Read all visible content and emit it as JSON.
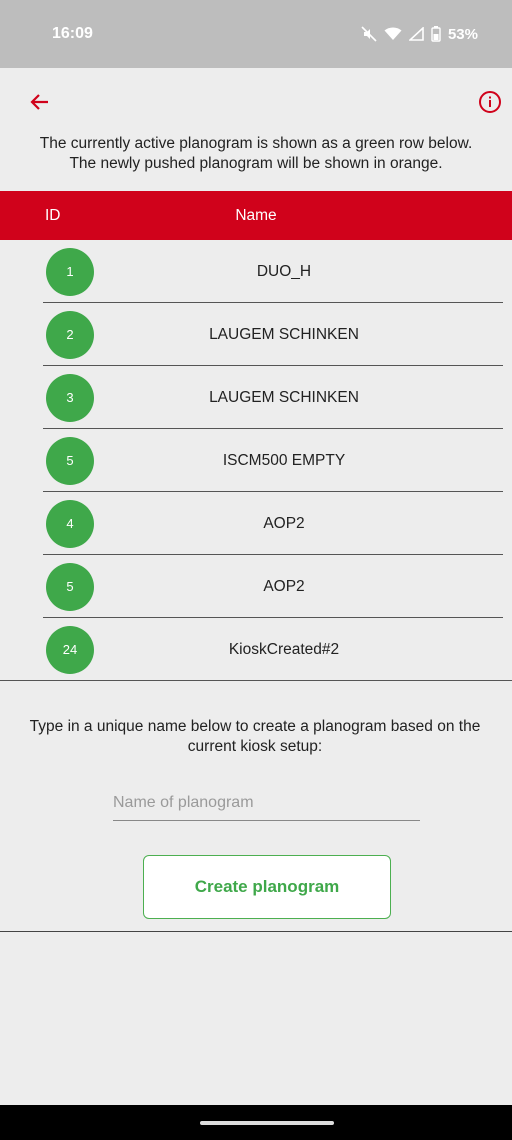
{
  "status_bar": {
    "time": "16:09",
    "battery": "53%",
    "icons": [
      "mute-icon",
      "wifi-icon",
      "signal-icon",
      "battery-icon"
    ]
  },
  "toolbar": {
    "back_icon": "arrow-left-icon",
    "info_icon": "info-circle-icon",
    "accent_color": "#d0021b"
  },
  "intro_text": {
    "line1": "The currently active planogram is shown as a green row below.",
    "line2": "The newly pushed planogram will be shown in orange."
  },
  "table": {
    "header_id": "ID",
    "header_name": "Name",
    "header_color": "#d0021b",
    "badge_color": "#3fa84a",
    "rows": [
      {
        "id": "1",
        "name": "DUO_H"
      },
      {
        "id": "2",
        "name": "LAUGEM SCHINKEN"
      },
      {
        "id": "3",
        "name": "LAUGEM SCHINKEN"
      },
      {
        "id": "5",
        "name": "ISCM500 EMPTY"
      },
      {
        "id": "4",
        "name": "AOP2"
      },
      {
        "id": "5",
        "name": "AOP2"
      },
      {
        "id": "24",
        "name": "KioskCreated#2"
      }
    ]
  },
  "create": {
    "hint_line1": "Type in a unique name below to create a planogram based on the",
    "hint_line2": "current kiosk setup:",
    "input_placeholder": "Name of planogram",
    "input_value": "",
    "button_label": "Create planogram"
  }
}
